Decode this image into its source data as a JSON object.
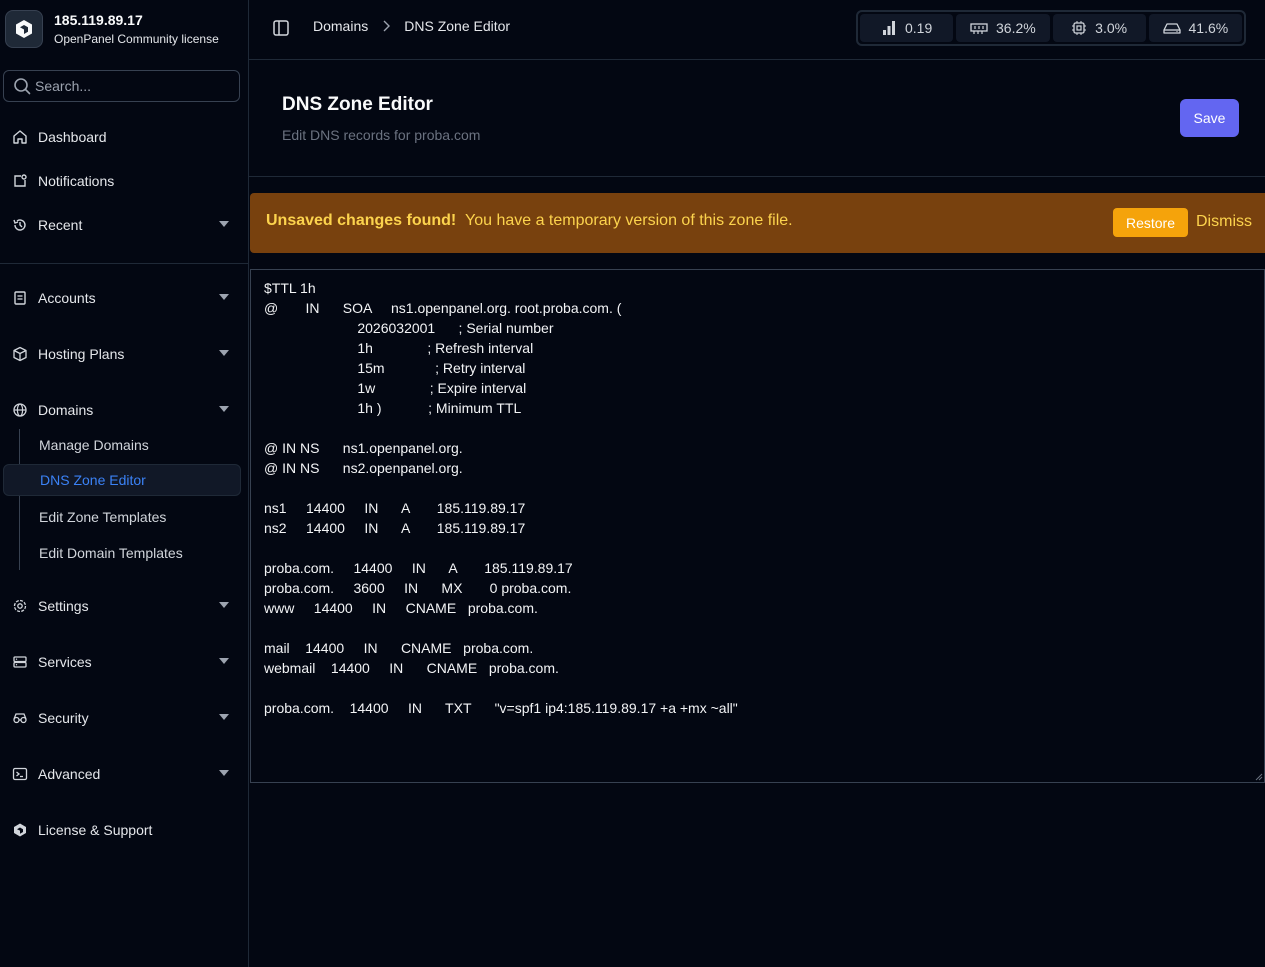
{
  "brand": {
    "ip": "185.119.89.17",
    "license": "OpenPanel Community license"
  },
  "search": {
    "placeholder": "Search..."
  },
  "sidebar": {
    "primary": [
      {
        "label": "Dashboard",
        "icon": "home-icon"
      },
      {
        "label": "Notifications",
        "icon": "notification-icon"
      },
      {
        "label": "Recent",
        "icon": "history-icon",
        "expandable": true
      }
    ],
    "groups": [
      {
        "label": "Accounts",
        "icon": "accounts-icon",
        "expandable": true
      },
      {
        "label": "Hosting Plans",
        "icon": "package-icon",
        "expandable": true
      },
      {
        "label": "Domains",
        "icon": "globe-icon",
        "expandable": true,
        "expanded": true
      },
      {
        "label": "Settings",
        "icon": "gear-icon",
        "expandable": true
      },
      {
        "label": "Services",
        "icon": "server-icon",
        "expandable": true
      },
      {
        "label": "Security",
        "icon": "security-icon",
        "expandable": true
      },
      {
        "label": "Advanced",
        "icon": "terminal-icon",
        "expandable": true
      },
      {
        "label": "License & Support",
        "icon": "support-icon",
        "expandable": false
      }
    ],
    "domains_children": [
      {
        "label": "Manage Domains",
        "active": false
      },
      {
        "label": "DNS Zone Editor",
        "active": true
      },
      {
        "label": "Edit Zone Templates",
        "active": false
      },
      {
        "label": "Edit Domain Templates",
        "active": false
      }
    ]
  },
  "breadcrumb": {
    "parent": "Domains",
    "current": "DNS Zone Editor"
  },
  "stats": {
    "load": "0.19",
    "ram": "36.2%",
    "cpu": "3.0%",
    "disk": "41.6%"
  },
  "page": {
    "title": "DNS Zone Editor",
    "subtitle": "Edit DNS records for proba.com",
    "save_label": "Save"
  },
  "alert": {
    "strong": "Unsaved changes found!",
    "message": "You have a temporary version of this zone file.",
    "restore_label": "Restore",
    "dismiss_label": "Dismiss"
  },
  "zone_file": "$TTL 1h\n@       IN      SOA     ns1.openpanel.org. root.proba.com. (\n                        2026032001      ; Serial number\n                        1h              ; Refresh interval\n                        15m             ; Retry interval\n                        1w              ; Expire interval\n                        1h )            ; Minimum TTL\n\n@ IN NS      ns1.openpanel.org.\n@ IN NS      ns2.openpanel.org.\n\nns1     14400     IN      A       185.119.89.17\nns2     14400     IN      A       185.119.89.17\n\nproba.com.     14400     IN      A       185.119.89.17\nproba.com.     3600     IN      MX       0 proba.com.\nwww     14400     IN     CNAME   proba.com.\n\nmail    14400     IN      CNAME   proba.com.\nwebmail    14400     IN      CNAME   proba.com.\n\nproba.com.    14400     IN      TXT      \"v=spf1 ip4:185.119.89.17 +a +mx ~all\"",
  "colors": {
    "background": "#030712",
    "accent": "#6366f1",
    "active_link": "#3b82f6",
    "alert_bg": "#78410e",
    "alert_text": "#fcd34d",
    "restore_bg": "#f5a30b"
  }
}
